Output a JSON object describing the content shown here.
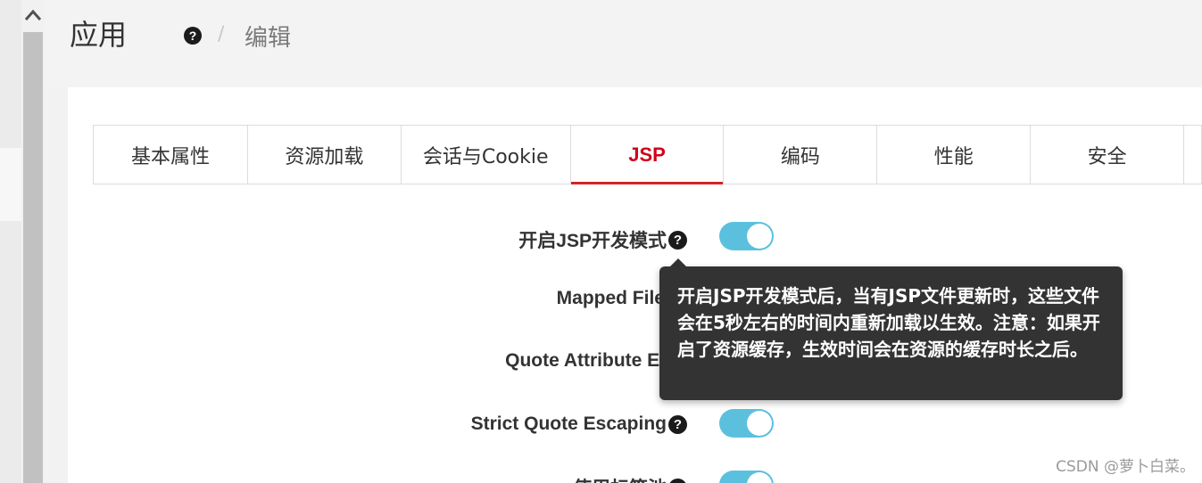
{
  "header": {
    "title": "应用",
    "help_icon": "?",
    "separator": "/",
    "breadcrumb": "编辑"
  },
  "tabs": [
    {
      "label": "基本属性",
      "active": false
    },
    {
      "label": "资源加载",
      "active": false
    },
    {
      "label": "会话与Cookie",
      "active": false
    },
    {
      "label": "JSP",
      "active": true
    },
    {
      "label": "编码",
      "active": false
    },
    {
      "label": "性能",
      "active": false
    },
    {
      "label": "安全",
      "active": false
    }
  ],
  "form": {
    "rows": [
      {
        "label": "开启JSP开发模式",
        "help": "?",
        "toggle": true
      },
      {
        "label": "Mapped File",
        "help": "",
        "toggle": null
      },
      {
        "label": "Quote Attribute El",
        "help": "",
        "toggle": null
      },
      {
        "label": "Strict Quote Escaping",
        "help": "?",
        "toggle": true
      },
      {
        "label": "使用标签池",
        "help": "?",
        "toggle": true
      }
    ]
  },
  "tooltip": {
    "text": "开启JSP开发模式后，当有JSP文件更新时，这些文件会在5秒左右的时间内重新加载以生效。注意：如果开启了资源缓存，生效时间会在资源的缓存时长之后。"
  },
  "watermark": "CSDN @萝卜白菜。",
  "colors": {
    "accent": "#d3242c",
    "toggle_on": "#5bc0de",
    "tooltip_bg": "#333333"
  }
}
